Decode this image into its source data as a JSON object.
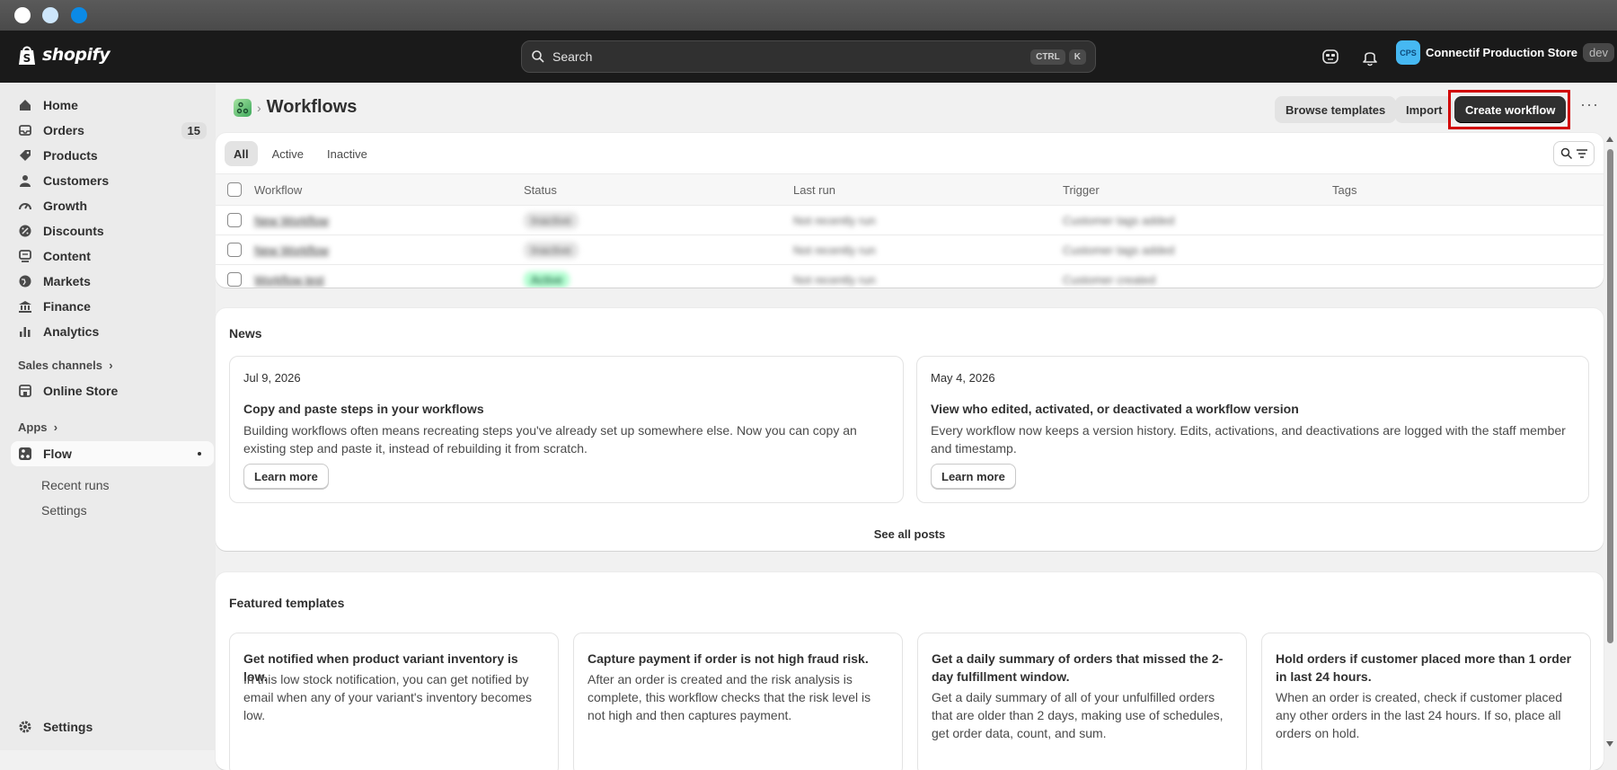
{
  "window": {
    "controls": [
      "close",
      "minimize",
      "maximize"
    ]
  },
  "topbar": {
    "brand": "shopify",
    "search_placeholder": "Search",
    "shortcut_key1": "CTRL",
    "shortcut_key2": "K",
    "store_avatar": "CPS",
    "store_name": "Connectif Production Store",
    "store_env": "dev"
  },
  "sidebar": {
    "items": [
      {
        "label": "Home",
        "icon": "home-icon"
      },
      {
        "label": "Orders",
        "icon": "inbox-icon",
        "badge": "15"
      },
      {
        "label": "Products",
        "icon": "tag-icon"
      },
      {
        "label": "Customers",
        "icon": "person-icon"
      },
      {
        "label": "Growth",
        "icon": "gauge-icon"
      },
      {
        "label": "Discounts",
        "icon": "discount-icon"
      },
      {
        "label": "Content",
        "icon": "content-icon"
      },
      {
        "label": "Markets",
        "icon": "globe-icon"
      },
      {
        "label": "Finance",
        "icon": "bank-icon"
      },
      {
        "label": "Analytics",
        "icon": "bar-chart-icon"
      }
    ],
    "sales_channels_label": "Sales channels",
    "online_store_label": "Online Store",
    "apps_label": "Apps",
    "flow_label": "Flow",
    "recent_runs_label": "Recent runs",
    "flow_settings_label": "Settings",
    "settings_label": "Settings"
  },
  "page": {
    "title": "Workflows",
    "breadcrumb_sep": "›",
    "browse_templates": "Browse templates",
    "import": "Import",
    "create_workflow": "Create workflow",
    "more": "···"
  },
  "workflows": {
    "tabs": [
      "All",
      "Active",
      "Inactive"
    ],
    "columns": [
      "Workflow",
      "Status",
      "Last run",
      "Trigger",
      "Tags"
    ],
    "rows": [
      {
        "name": "New Workflow",
        "status": "Inactive",
        "last_run": "Not recently run",
        "trigger": "Customer tags added",
        "tags": ""
      },
      {
        "name": "New Workflow",
        "status": "Inactive",
        "last_run": "Not recently run",
        "trigger": "Customer tags added",
        "tags": ""
      },
      {
        "name": "Workflow test",
        "status": "Active",
        "last_run": "Not recently run",
        "trigger": "Customer created",
        "tags": ""
      }
    ]
  },
  "news": {
    "title": "News",
    "items": [
      {
        "date": "Jul 9, 2026",
        "heading": "Copy and paste steps in your workflows",
        "body": "Building workflows often means recreating steps you've already set up somewhere else. Now you can copy an existing step and paste it, instead of rebuilding it from scratch.",
        "cta": "Learn more"
      },
      {
        "date": "May 4, 2026",
        "heading": "View who edited, activated, or deactivated a workflow version",
        "body": "Every workflow now keeps a version history. Edits, activations, and deactivations are logged with the staff member and timestamp.",
        "cta": "Learn more"
      }
    ],
    "see_all": "See all posts"
  },
  "featured": {
    "title": "Featured templates",
    "items": [
      {
        "heading": "Get notified when product variant inventory is low.",
        "body": "In this low stock notification, you can get notified by email when any of your variant's inventory becomes low."
      },
      {
        "heading": "Capture payment if order is not high fraud risk.",
        "body": "After an order is created and the risk analysis is complete, this workflow checks that the risk level is not high and then captures payment."
      },
      {
        "heading": "Get a daily summary of orders that missed the 2-day fulfillment window.",
        "body": "Get a daily summary of all of your unfulfilled orders that are older than 2 days, making use of schedules, get order data, count, and sum."
      },
      {
        "heading": "Hold orders if customer placed more than 1 order in last 24 hours.",
        "body": "When an order is created, check if customer placed any other orders in the last 24 hours. If so, place all orders on hold."
      }
    ]
  },
  "colors": {
    "highlight": "#d10000",
    "primary": "#303030",
    "active_pill": "#b4fed2"
  }
}
